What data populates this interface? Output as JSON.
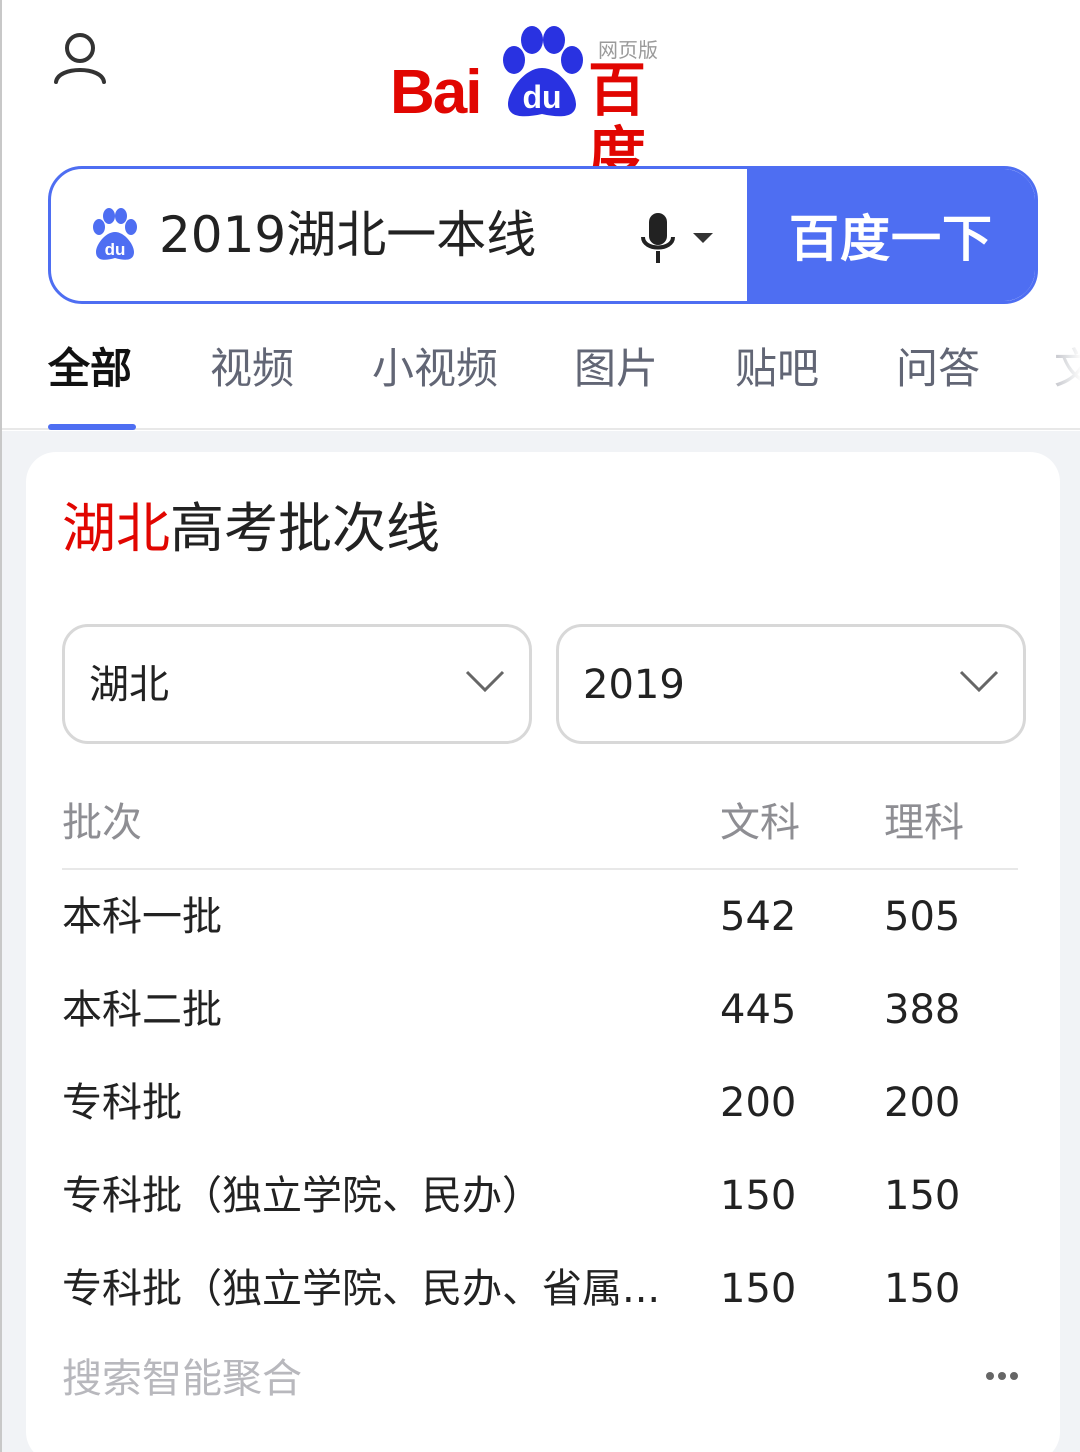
{
  "header": {
    "logo_latin": "Bai",
    "logo_du": "du",
    "logo_cn": "百度",
    "logo_web": "网页版"
  },
  "search": {
    "query": "2019湖北一本线",
    "button_label": "百度一下"
  },
  "tabs": [
    {
      "label": "全部",
      "active": true
    },
    {
      "label": "视频"
    },
    {
      "label": "小视频"
    },
    {
      "label": "图片"
    },
    {
      "label": "贴吧"
    },
    {
      "label": "问答"
    },
    {
      "label": "文"
    }
  ],
  "card": {
    "title_highlight": "湖北",
    "title_rest": "高考批次线",
    "province_select": "湖北",
    "year_select": "2019",
    "table": {
      "headers": {
        "batch": "批次",
        "wen": "文科",
        "li": "理科"
      },
      "rows": [
        {
          "batch": "本科一批",
          "wen": "542",
          "li": "505"
        },
        {
          "batch": "本科二批",
          "wen": "445",
          "li": "388"
        },
        {
          "batch": "专科批",
          "wen": "200",
          "li": "200"
        },
        {
          "batch": "专科批（独立学院、民办）",
          "wen": "150",
          "li": "150"
        },
        {
          "batch": "专科批（独立学院、民办、省属...",
          "wen": "150",
          "li": "150"
        }
      ]
    },
    "footer_label": "搜索智能聚合"
  },
  "colors": {
    "brand_red": "#e10601",
    "brand_blue": "#4e6ef2"
  }
}
